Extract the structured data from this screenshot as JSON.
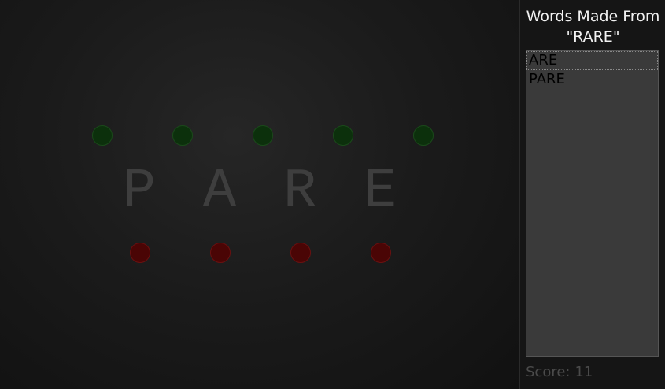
{
  "board": {
    "letters": [
      "P",
      "A",
      "R",
      "E"
    ],
    "green_dot_count": 5,
    "red_dot_count": 4,
    "colors": {
      "green_dot": "#0c300c",
      "red_dot": "#4a0505",
      "letter": "#3e3e3e"
    }
  },
  "sidebar": {
    "title_line1": "Words Made From",
    "title_line2": "\"RARE\"",
    "words": [
      "ARE",
      "PARE"
    ],
    "selected_word": "ARE",
    "score_label": "Score:",
    "score_value": "11"
  }
}
